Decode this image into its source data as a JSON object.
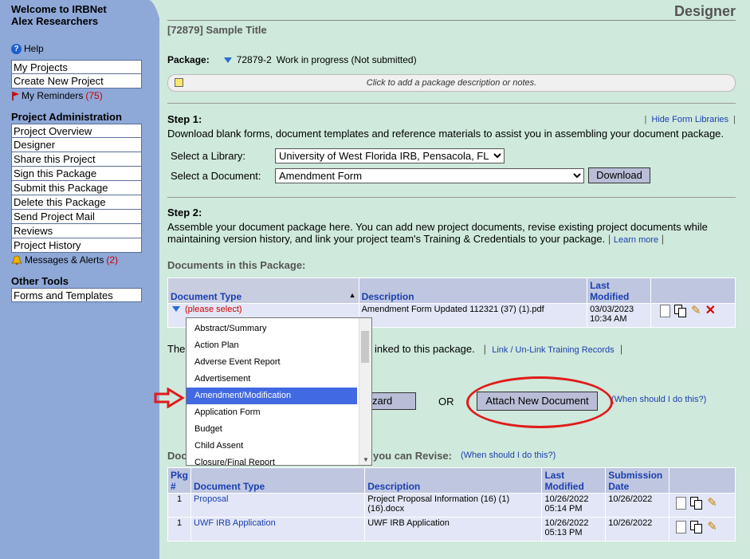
{
  "sidebar": {
    "welcome_line1": "Welcome to IRBNet",
    "welcome_line2": "Alex Researchers",
    "help": "Help",
    "top_items": [
      "My Projects",
      "Create New Project"
    ],
    "reminders_label": "My Reminders",
    "reminders_count": "(75)",
    "project_admin_title": "Project Administration",
    "project_items": [
      "Project Overview",
      "Designer",
      "Share this Project",
      "Sign this Package",
      "Submit this Package",
      "Delete this Package",
      "Send Project Mail",
      "Reviews",
      "Project History"
    ],
    "messages_label": "Messages & Alerts",
    "messages_count": "(2)",
    "other_tools_title": "Other Tools",
    "tools_items": [
      "Forms and Templates"
    ]
  },
  "main": {
    "page_title": "Designer",
    "project_title": "[72879] Sample Title",
    "package_label": "Package:",
    "package_id": "72879-2",
    "package_status": "Work in progress (Not submitted)",
    "note_placeholder": "Click to add a package description or notes.",
    "step1_title": "Step 1:",
    "hide_libraries": "Hide Form Libraries",
    "step1_text": "Download blank forms, document templates and reference materials to assist you in assembling your document package.",
    "library_label": "Select a Library:",
    "library_value": "University of West Florida IRB, Pensacola, FL",
    "document_label": "Select a Document:",
    "document_value": "Amendment Form",
    "download_button": "Download",
    "step2_title": "Step 2:",
    "step2_text": "Assemble your document package here. You can add new project documents, revise existing project documents while maintaining version history, and link your project team's Training & Credentials to your package.",
    "learn_more": "Learn more",
    "docs_in_package": "Documents in this Package:",
    "pkg_table": {
      "headers": [
        "Document Type",
        "Description",
        "Last Modified"
      ],
      "row": {
        "type": "(please select)",
        "description": "Amendment Form Updated 112321 (37) (1).pdf",
        "modified": "03/03/2023 10:34 AM"
      }
    },
    "training_prefix": "The",
    "training_suffix": "inked to this package.",
    "link_training": "Link / Un-Link Training Records",
    "wizard_button_tail": "zard",
    "or_text": "OR",
    "attach_button": "Attach New Document",
    "when_should": "(When should I do this?)",
    "revise_prefix": "Doc",
    "revise_suffix": "you can Revise:",
    "revise_when": "(When should I do this?)",
    "revise_table": {
      "headers": [
        "Pkg #",
        "Document Type",
        "Description",
        "Last Modified",
        "Submission Date"
      ],
      "rows": [
        {
          "pkg": "1",
          "type": "Proposal",
          "description": "Project Proposal Information (16) (1) (16).docx",
          "modified": "10/26/2022 05:14 PM",
          "submitted": "10/26/2022"
        },
        {
          "pkg": "1",
          "type": "UWF IRB Application",
          "description": "UWF IRB Application",
          "modified": "10/26/2022 05:13 PM",
          "submitted": "10/26/2022"
        }
      ]
    }
  },
  "dropdown_options": [
    "Abstract/Summary",
    "Action Plan",
    "Adverse Event Report",
    "Advertisement",
    "Amendment/Modification",
    "Application Form",
    "Budget",
    "Child Assent",
    "Closure/Final Report"
  ],
  "dropdown_selected": "Amendment/Modification",
  "colors": {
    "sidebar": "#8ea8d8",
    "content": "#cfe9dc",
    "accent_link": "#1a3fb0",
    "annotation": "#e01b1b",
    "selected": "#4169e1"
  }
}
